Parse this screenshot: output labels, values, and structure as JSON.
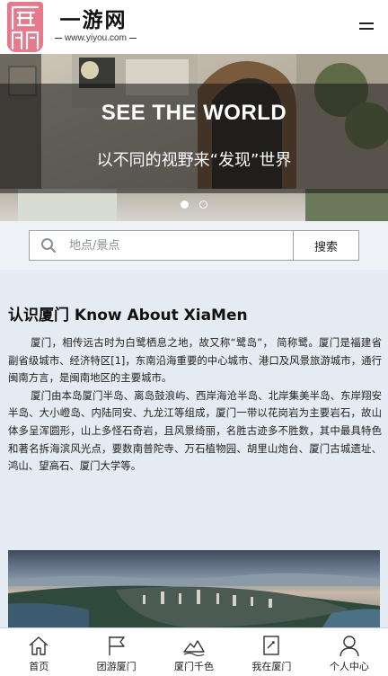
{
  "header": {
    "brand_name": "一游网",
    "brand_url": "www.yiyou.com"
  },
  "hero": {
    "title": "SEE THE WORLD",
    "subtitle": "以不同的视野来“发现”世界",
    "slide_count": 2,
    "active_slide": 1
  },
  "search": {
    "placeholder": "地点/景点",
    "value": "",
    "button_label": "搜索"
  },
  "about": {
    "title": "认识厦门 Know About XiaMen",
    "paragraphs": [
      "厦门，相传远古时为白鹭栖息之地，故又称“鹭岛”， 简称鹭。厦门是福建省副省级城市、经济特区[1]，东南沿海重要的中心城市、港口及风景旅游城市，通行闽南方言，是闽南地区的主要城市。",
      "厦门由本岛厦门半岛、离岛鼓浪屿、西岸海沧半岛、北岸集美半岛、东岸翔安半岛、大小嶝岛、内陆同安、九龙江等组成，厦门一带以花岗岩为主要岩石，故山体多呈浑圆形，山上多怪石奇岩，且风景绮丽，名胜古迹多不胜数，其中最具特色和著名拆海滨风光点，要数南普陀寺、万石植物园、胡里山炮台、厦门古城遗址、鸿山、望高石、厦门大学等。"
    ]
  },
  "bottom_nav": {
    "items": [
      {
        "label": "首页",
        "icon": "home-icon"
      },
      {
        "label": "团游厦门",
        "icon": "flag-icon"
      },
      {
        "label": "厦门千色",
        "icon": "landscape-icon"
      },
      {
        "label": "我在厦门",
        "icon": "note-icon"
      },
      {
        "label": "个人中心",
        "icon": "user-icon"
      }
    ]
  },
  "colors": {
    "logo_pink": "#e8798a",
    "about_bg": "#e4ebf2",
    "search_bg": "#eef2f6"
  }
}
